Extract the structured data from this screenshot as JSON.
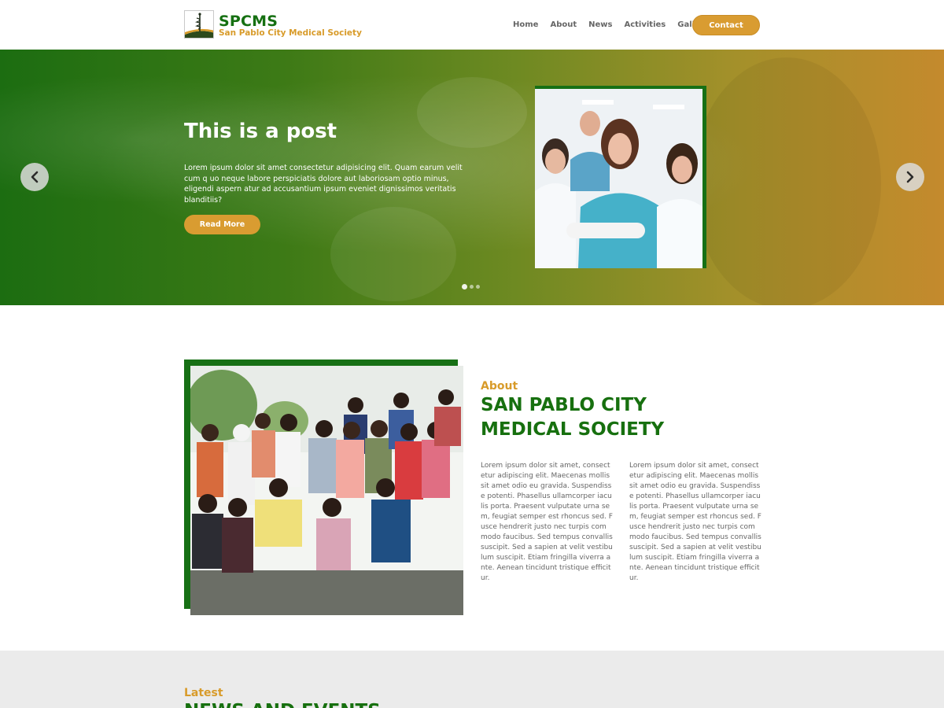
{
  "header": {
    "brand_name": "SPCMS",
    "brand_tagline": "San Pablo City Medical Society",
    "nav": [
      "Home",
      "About",
      "News",
      "Activities",
      "Gallery"
    ],
    "contact_label": "Contact"
  },
  "hero": {
    "title": "This is a post",
    "text": "Lorem ipsum dolor sit amet consectetur adipisicing elit. Quam earum velit cum q uo neque labore perspiciatis dolore aut laboriosam optio minus, eligendi aspern atur ad accusantium ipsum eveniet dignissimos veritatis blanditiis?",
    "button_label": "Read More",
    "slide_count": 3,
    "active_slide": 1
  },
  "about": {
    "kicker": "About",
    "title": "SAN PABLO CITY MEDICAL SOCIETY",
    "col1": "Lorem ipsum dolor sit amet, consectetur adipiscing elit. Maecenas mollis sit amet odio eu gravida. Suspendisse potenti. Phasellus ullamcorper iaculis porta. Praesent vulputate urna sem, feugiat semper est rhoncus sed. Fusce hendrerit justo nec turpis commodo faucibus. Sed tempus convallis suscipit. Sed a sapien at velit vestibulum suscipit. Etiam fringilla viverra ante. Aenean tincidunt tristique efficitur.",
    "col2": "Lorem ipsum dolor sit amet, consectetur adipiscing elit. Maecenas mollis sit amet odio eu gravida. Suspendisse potenti. Phasellus ullamcorper iaculis porta. Praesent vulputate urna sem, feugiat semper est rhoncus sed. Fusce hendrerit justo nec turpis commodo faucibus. Sed tempus convallis suscipit. Sed a sapien at velit vestibulum suscipit. Etiam fringilla viverra ante. Aenean tincidunt tristique efficitur."
  },
  "latest": {
    "kicker": "Latest",
    "title": "NEWS AND EVENTS"
  },
  "colors": {
    "brand_green": "#17700f",
    "accent_gold": "#d99c31"
  }
}
